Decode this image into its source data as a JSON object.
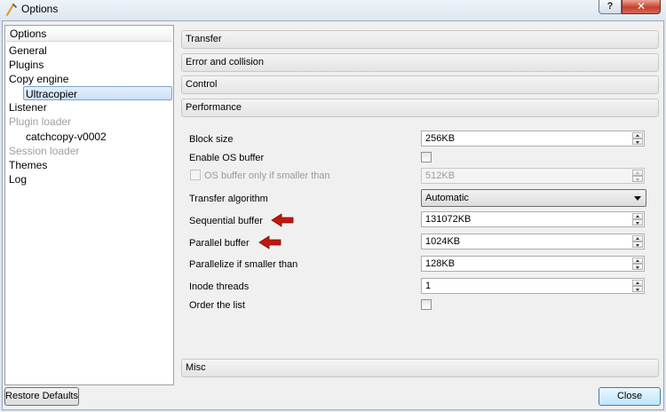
{
  "window": {
    "title": "Options",
    "help_label": "?",
    "close_label": "✕"
  },
  "sidebar": {
    "header": "Options",
    "items": [
      {
        "label": "General"
      },
      {
        "label": "Plugins"
      },
      {
        "label": "Copy engine"
      },
      {
        "label": "Ultracopier"
      },
      {
        "label": "Listener"
      },
      {
        "label": "Plugin loader"
      },
      {
        "label": "catchcopy-v0002"
      },
      {
        "label": "Session loader"
      },
      {
        "label": "Themes"
      },
      {
        "label": "Log"
      }
    ]
  },
  "sections": {
    "transfer": "Transfer",
    "error": "Error and collision",
    "control": "Control",
    "performance": "Performance",
    "misc": "Misc"
  },
  "performance": {
    "block_size_label": "Block size",
    "block_size_value": "256KB",
    "enable_os_buffer_label": "Enable OS buffer",
    "os_buffer_smaller_label": "OS buffer only if smaller than",
    "os_buffer_smaller_value": "512KB",
    "transfer_algorithm_label": "Transfer algorithm",
    "transfer_algorithm_value": "Automatic",
    "sequential_buffer_label": "Sequential buffer",
    "sequential_buffer_value": "131072KB",
    "parallel_buffer_label": "Parallel buffer",
    "parallel_buffer_value": "1024KB",
    "parallelize_label": "Parallelize if smaller than",
    "parallelize_value": "128KB",
    "inode_threads_label": "Inode threads",
    "inode_threads_value": "1",
    "order_list_label": "Order the list"
  },
  "footer": {
    "restore_defaults": "Restore Defaults",
    "close": "Close"
  },
  "colors": {
    "annotation_arrow": "#c0180c",
    "selection": "#c9e0f8"
  }
}
